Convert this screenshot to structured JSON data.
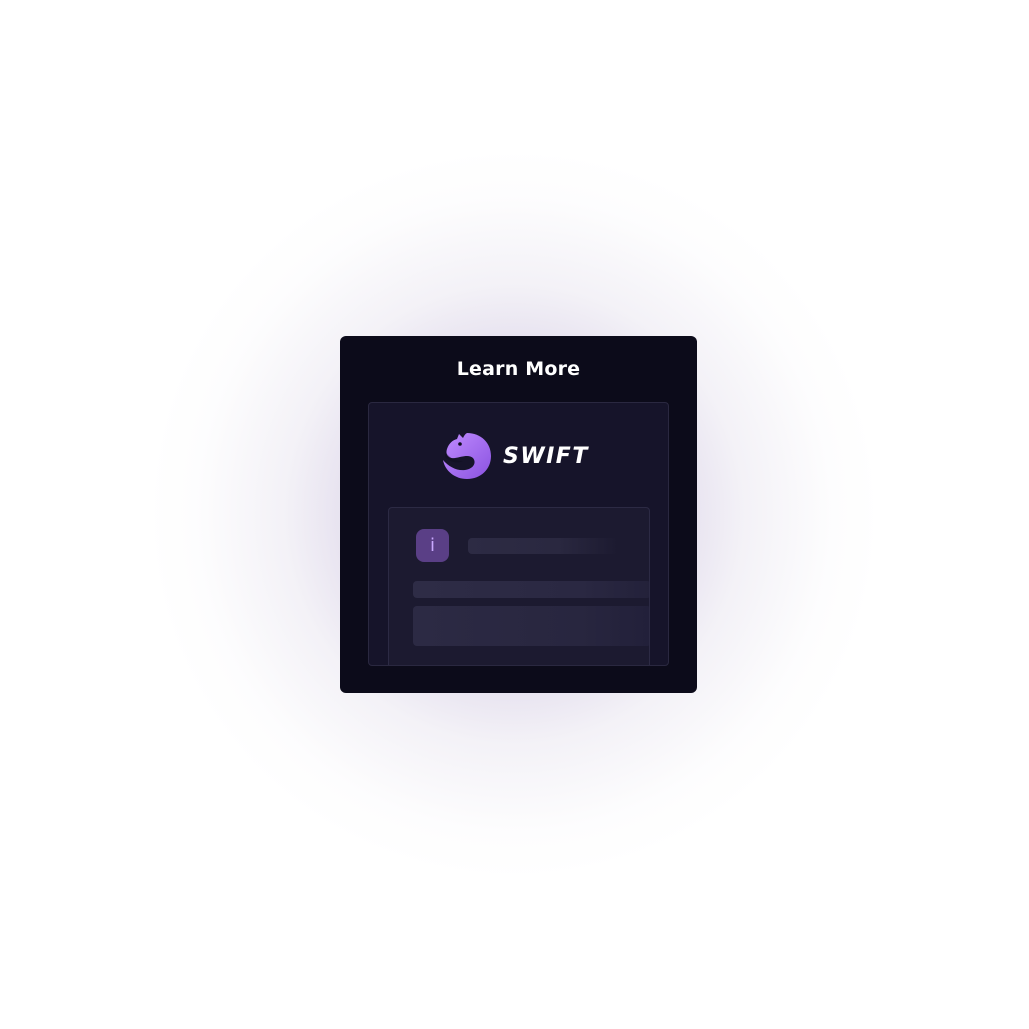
{
  "dialog": {
    "title": "Learn More"
  },
  "brand": {
    "name": "SWIFT",
    "logo_icon": "swift-serpent-logo-icon",
    "accent_color": "#a06cf0"
  },
  "info": {
    "icon_glyph": "i",
    "icon": "info-icon",
    "badge_color": "#5a3f86"
  },
  "colors": {
    "card_background": "#0c0b1a",
    "panel_background": "#16142a"
  }
}
